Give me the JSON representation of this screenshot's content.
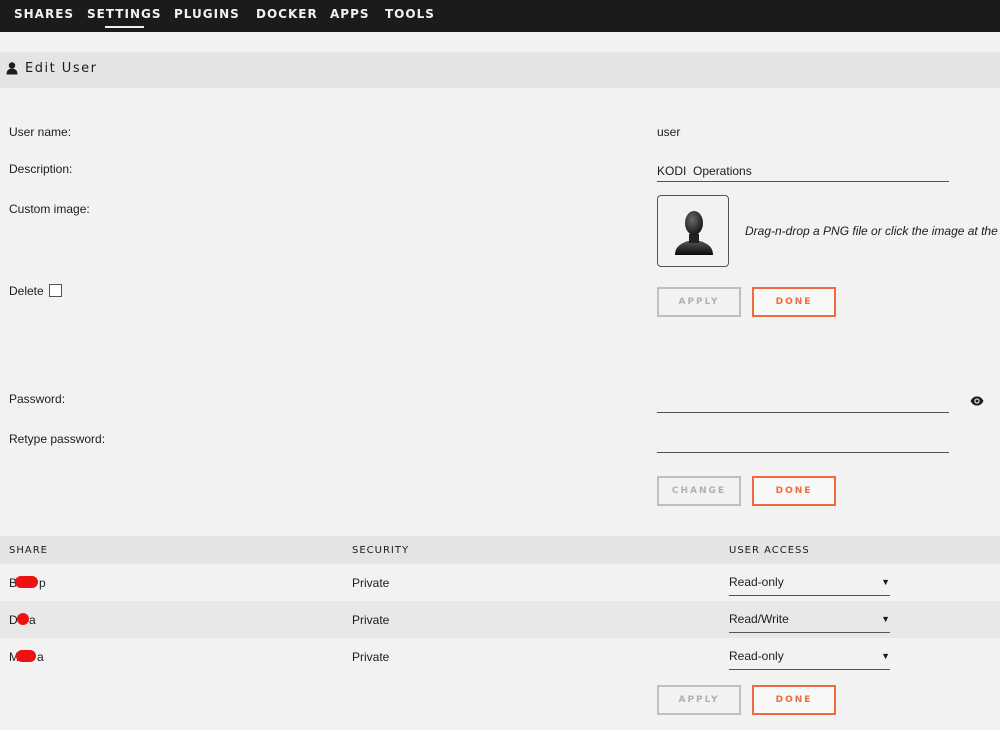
{
  "nav": {
    "items": [
      {
        "label": "SHARES"
      },
      {
        "label": "SETTINGS"
      },
      {
        "label": "PLUGINS"
      },
      {
        "label": "DOCKER"
      },
      {
        "label": "APPS"
      },
      {
        "label": "TOOLS"
      }
    ],
    "active": "SETTINGS"
  },
  "page": {
    "icon": "user-icon",
    "title": "Edit User"
  },
  "form": {
    "username_label": "User name:",
    "username_value": "user",
    "description_label": "Description:",
    "description_value": "KODI  Operations",
    "custom_image_label": "Custom image:",
    "custom_image_icon": "user-silhouette-icon",
    "custom_image_hint": "Drag-n-drop a PNG file or click the image at the left.",
    "delete_label": "Delete",
    "delete_checked": false,
    "apply_label": "APPLY",
    "done_label": "DONE"
  },
  "password": {
    "password_label": "Password:",
    "retype_label": "Retype password:",
    "show_icon": "eye-icon",
    "change_label": "CHANGE",
    "done_label": "DONE"
  },
  "shares": {
    "headers": {
      "share": "SHARE",
      "security": "SECURITY",
      "access": "USER ACCESS"
    },
    "rows": [
      {
        "name_start": "B",
        "name_end": "p",
        "security": "Private",
        "access": "Read-only"
      },
      {
        "name_start": "D",
        "name_end": "a",
        "security": "Private",
        "access": "Read/Write"
      },
      {
        "name_start": "M",
        "name_end": "a",
        "security": "Private",
        "access": "Read-only"
      }
    ],
    "apply_label": "APPLY",
    "done_label": "DONE",
    "arrow": "▼"
  },
  "colors": {
    "nav_bg": "#1c1b1b",
    "accent": "#ef6a3c",
    "redaction": "#ee1111"
  }
}
